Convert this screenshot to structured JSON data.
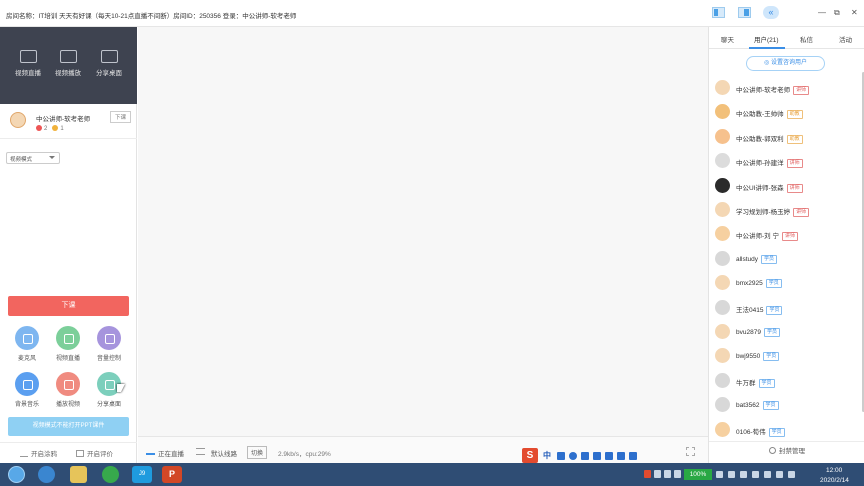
{
  "titlebar": {
    "title": "房间名称：IT培训 天天有好课（每天10-21点直播不间断）房间ID：250356 登录：中公讲师-软考老师"
  },
  "media_tools": [
    {
      "label": "视频直播",
      "icon": "camera-icon"
    },
    {
      "label": "视频播放",
      "icon": "video-play-icon"
    },
    {
      "label": "分享桌面",
      "icon": "share-desktop-icon"
    }
  ],
  "teacher": {
    "name": "中公讲师-软考老师",
    "flowers": "2",
    "likes": "1",
    "lower_btn": "下课"
  },
  "mode_select": {
    "value": "视频模式"
  },
  "end_class_label": "下课",
  "tools": [
    {
      "label": "麦克风",
      "color": "#7eb6f0",
      "icon": "microphone-icon"
    },
    {
      "label": "视频直播",
      "color": "#7ccf9a",
      "icon": "camera-icon"
    },
    {
      "label": "音量控制",
      "color": "#a694dd",
      "icon": "volume-icon"
    },
    {
      "label": "背景音乐",
      "color": "#5b9ff0",
      "icon": "music-icon"
    },
    {
      "label": "播放视频",
      "color": "#f08b80",
      "icon": "video-play-icon"
    },
    {
      "label": "分享桌面",
      "color": "#7ccfbc",
      "icon": "share-desktop-icon"
    }
  ],
  "ppt_notice": "视频模式不能打开PPT课件",
  "left_footer": {
    "open_graffiti": "开启涂鸦",
    "open_evaluation": "开启评价"
  },
  "statusbar": {
    "live": "正在直播",
    "line": "默认线路",
    "switch": "切换",
    "rate": "2.9kb/s，cpu:29%"
  },
  "right_tabs": [
    {
      "label": "聊天"
    },
    {
      "label": "用户(21)"
    },
    {
      "label": "私信"
    },
    {
      "label": "活动"
    }
  ],
  "consult_btn": "设置咨询用户",
  "users": [
    {
      "name": "中公讲师-软考老师",
      "badge": "讲师",
      "type": "lecturer",
      "avatar": "#f4d7b4"
    },
    {
      "name": "中公助教-王帅帅",
      "badge": "助教",
      "type": "assistant",
      "avatar": "#f2c07a"
    },
    {
      "name": "中公助教-郭双利",
      "badge": "助教",
      "type": "assistant",
      "avatar": "#f6c18d"
    },
    {
      "name": "中公讲师-孙建洋",
      "badge": "讲师",
      "type": "lecturer",
      "avatar": "#dcdcdc"
    },
    {
      "name": "中公UI讲师-张森",
      "badge": "讲师",
      "type": "lecturer",
      "avatar": "#2b2b2b"
    },
    {
      "name": "学习规划师-杨玉婷",
      "badge": "讲师",
      "type": "lecturer",
      "avatar": "#f4d7b4"
    },
    {
      "name": "中公讲师-刘 宁",
      "badge": "讲师",
      "type": "lecturer",
      "avatar": "#f6d0a0"
    },
    {
      "name": "allstudy",
      "badge": "学员",
      "type": "student",
      "avatar": "#d8d8d8"
    },
    {
      "name": "bmx2925",
      "badge": "学员",
      "type": "student",
      "avatar": "#f4d7b4"
    },
    {
      "name": "王法0415",
      "badge": "学员",
      "type": "student",
      "avatar": "#d8d8d8"
    },
    {
      "name": "bvu2879",
      "badge": "学员",
      "type": "student",
      "avatar": "#f4d7b4"
    },
    {
      "name": "bwj9550",
      "badge": "学员",
      "type": "student",
      "avatar": "#f4d7b4"
    },
    {
      "name": "牛万群",
      "badge": "学员",
      "type": "student",
      "avatar": "#d8d8d8"
    },
    {
      "name": "bat3562",
      "badge": "学员",
      "type": "student",
      "avatar": "#d8d8d8"
    },
    {
      "name": "0106-荀伟",
      "badge": "学员",
      "type": "student",
      "avatar": "#f6d0a0"
    }
  ],
  "ban_mgmt": "封禁管理",
  "taskbar": {
    "battery": "100%",
    "time": "12:00",
    "date": "2020/2/14",
    "ime_label": "中",
    "app4_label": "J9"
  }
}
